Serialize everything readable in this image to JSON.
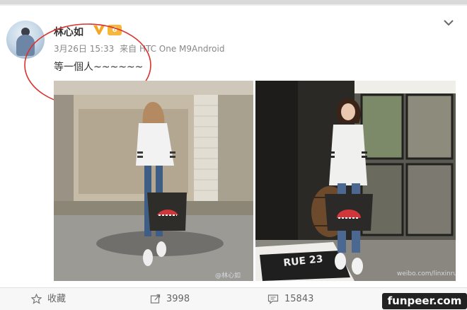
{
  "post": {
    "username": "林心如",
    "level": "6",
    "timestamp": "3月26日 15:33",
    "source": "来自 HTC One M9Android",
    "text": "等一個人~~~~~~"
  },
  "photos": {
    "photo1_watermark": "@林心如",
    "photo2_watermark": "weibo.com/linxinru",
    "photo2_sign_text": "RUE 23"
  },
  "actions": {
    "favorite_label": "收藏",
    "repost_count": "3998",
    "comment_count": "15843"
  },
  "site_mark": "funpeer.com",
  "colors": {
    "vip_badge": "#f5a623",
    "annotation_circle": "#d8322e",
    "level_badge": "#f6b73c"
  }
}
